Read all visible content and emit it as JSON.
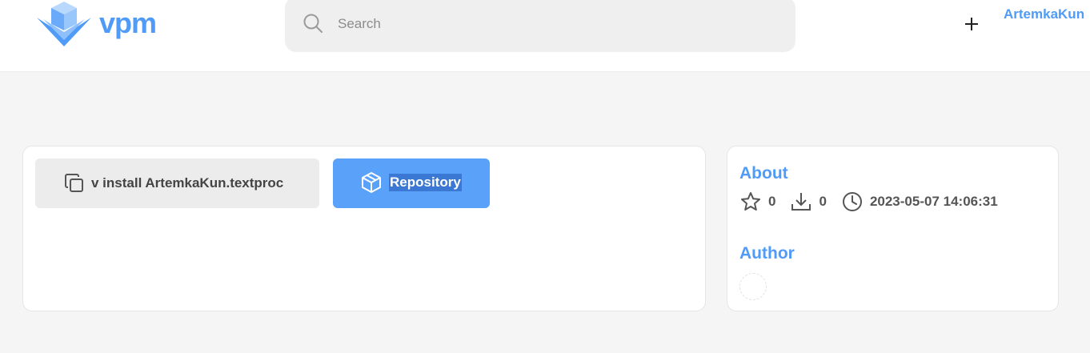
{
  "header": {
    "logo_text": "vpm",
    "search_placeholder": "Search",
    "add_label": "+",
    "username": "ArtemkaKun"
  },
  "main": {
    "install_command": "v install ArtemkaKun.textproc",
    "repository_label": "Repository"
  },
  "about": {
    "title": "About",
    "stars": "0",
    "downloads": "0",
    "updated": "2023-05-07 14:06:31"
  },
  "author": {
    "title": "Author"
  },
  "colors": {
    "accent": "#4f9bf7",
    "button_primary": "#5aa1f9",
    "background": "#f5f5f5"
  },
  "icons": [
    "logo-box-icon",
    "search-icon",
    "plus-icon",
    "copy-icon",
    "package-icon",
    "star-icon",
    "download-icon",
    "clock-icon"
  ]
}
